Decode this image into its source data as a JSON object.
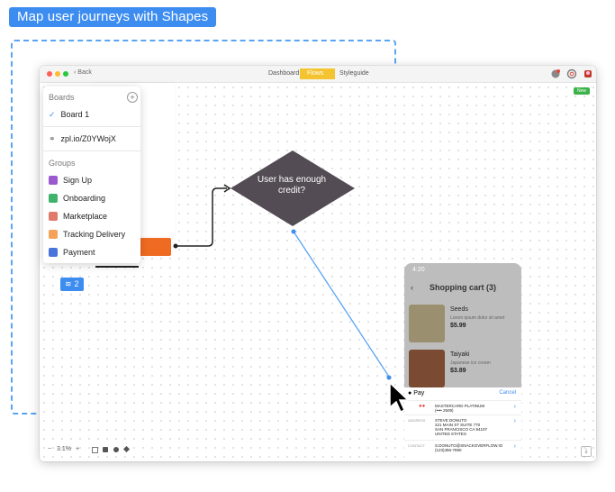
{
  "banner": {
    "title": "Map user journeys with Shapes"
  },
  "window": {
    "back_label": "Back",
    "tabs": [
      {
        "label": "Dashboard",
        "active": false
      },
      {
        "label": "Flows",
        "active": true
      },
      {
        "label": "Styleguide",
        "active": false
      }
    ],
    "new_badge": "New"
  },
  "panel": {
    "boards_title": "Boards",
    "board_name": "Board 1",
    "link": "zpl.io/Z0YWojX",
    "groups_title": "Groups",
    "groups": [
      {
        "label": "Sign Up",
        "color": "#9b59d0"
      },
      {
        "label": "Onboarding",
        "color": "#3fb36b"
      },
      {
        "label": "Marketplace",
        "color": "#e07a6a"
      },
      {
        "label": "Tracking Delivery",
        "color": "#f4a25a"
      },
      {
        "label": "Payment",
        "color": "#4a74d9"
      }
    ]
  },
  "layer_badge": {
    "count": "2"
  },
  "flow": {
    "decision_label": "User has enough credit?"
  },
  "phone": {
    "time": "4:20",
    "title": "Shopping cart (3)",
    "products": [
      {
        "name": "Seeds",
        "desc": "Lorem ipsum dolor sit amet",
        "price": "$5.99"
      },
      {
        "name": "Taiyaki",
        "desc": "Japanese ice cream",
        "price": "$3.89"
      }
    ],
    "pay_label": "Pay",
    "cancel": "Cancel",
    "card": "MASTERCARD PLATINUM\n(•••• 2509)",
    "address_label": "ADDRESS",
    "address": "STEVE DONUTO\n221 MAIN ST SUITE 770\nSAN FRANCISCO CA 94107\nUNITED STATES",
    "contact_label": "CONTACT",
    "contact": "S.DONUTO@SNACKOVERFLOW.IO\n(123)456-7890"
  },
  "zoom": {
    "level": "3.1%",
    "minus": "−",
    "plus": "+"
  }
}
